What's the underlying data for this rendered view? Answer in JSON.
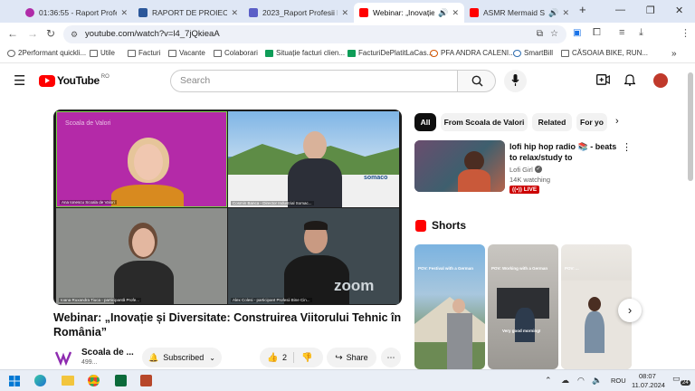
{
  "tabs": [
    {
      "title": "01:36:55 - Raport Profesii",
      "active": false,
      "fav_color": "#b02ca8"
    },
    {
      "title": "RAPORT DE PROIECT_PR",
      "active": false,
      "fav_color": "#2b579a"
    },
    {
      "title": "2023_Raport Profesii bine",
      "active": false,
      "fav_color": "#5b5fc7"
    },
    {
      "title": "Webinar: „Inovație și",
      "active": true,
      "fav_color": "#ff0000"
    },
    {
      "title": "ASMR Mermaid Spa",
      "active": false,
      "fav_color": "#ff0000"
    }
  ],
  "window_controls": {
    "new_tab": "+",
    "minimize": "—",
    "restore": "❐",
    "close": "✕"
  },
  "address": {
    "url": "youtube.com/watch?v=l4_7jQkieaA"
  },
  "bookmarks": [
    "2Performant quickli...",
    "Utile",
    "Facturi",
    "Vacante",
    "Colaborari",
    "Situație facturi clien...",
    "FacturiDePlatitLaCas...",
    "PFA ANDRA CALENI...",
    "SmartBill",
    "CĂSOAIA BIKE, RUN..."
  ],
  "youtube": {
    "logo_text": "YouTube",
    "country": "RO",
    "search_placeholder": "Search"
  },
  "video": {
    "participants": [
      {
        "name": "Ana Ionescu Scoala de Valori",
        "bg": "#b42aa8"
      },
      {
        "name": "Cosmin Banca - Director Industrial Somac...",
        "bg": "#5a8fc4"
      },
      {
        "name": "Ioana Ruxandra Tiuca - participantă Profe...",
        "bg": "#8d8f8c"
      },
      {
        "name": "Alex Colesi - participant Profesii Bine Cin...",
        "bg": "#3f4a50"
      }
    ],
    "zoom_watermark": "zoom",
    "tile_logo_text": "Scoala de Valori",
    "bg_sign_text": "somaco",
    "title": "Webinar: „Inovație și Diversitate: Construirea Viitorului Tehnic în România”",
    "channel": "Scoala de ...",
    "subs": "499...",
    "subscribed_label": "Subscribed",
    "likes": "2",
    "share_label": "Share"
  },
  "chips": [
    {
      "label": "All",
      "selected": true
    },
    {
      "label": "From Scoala de Valori",
      "selected": false
    },
    {
      "label": "Related",
      "selected": false
    },
    {
      "label": "For yo",
      "selected": false
    }
  ],
  "recommended": {
    "title": "lofi hip hop radio 📚 - beats to relax/study to",
    "channel": "Lofi Girl",
    "watching": "14K watching",
    "live_badge": "LIVE"
  },
  "shorts": {
    "heading": "Shorts",
    "items": [
      {
        "caption": "POV: Festival with a German"
      },
      {
        "caption": "POV: Working with a German"
      },
      {
        "caption": "POV: ..."
      }
    ],
    "short2_overlay": "Very good morning!"
  },
  "taskbar": {
    "lang": "ROU",
    "time": "08:07",
    "date": "11.07.2024",
    "notifications": "24"
  }
}
